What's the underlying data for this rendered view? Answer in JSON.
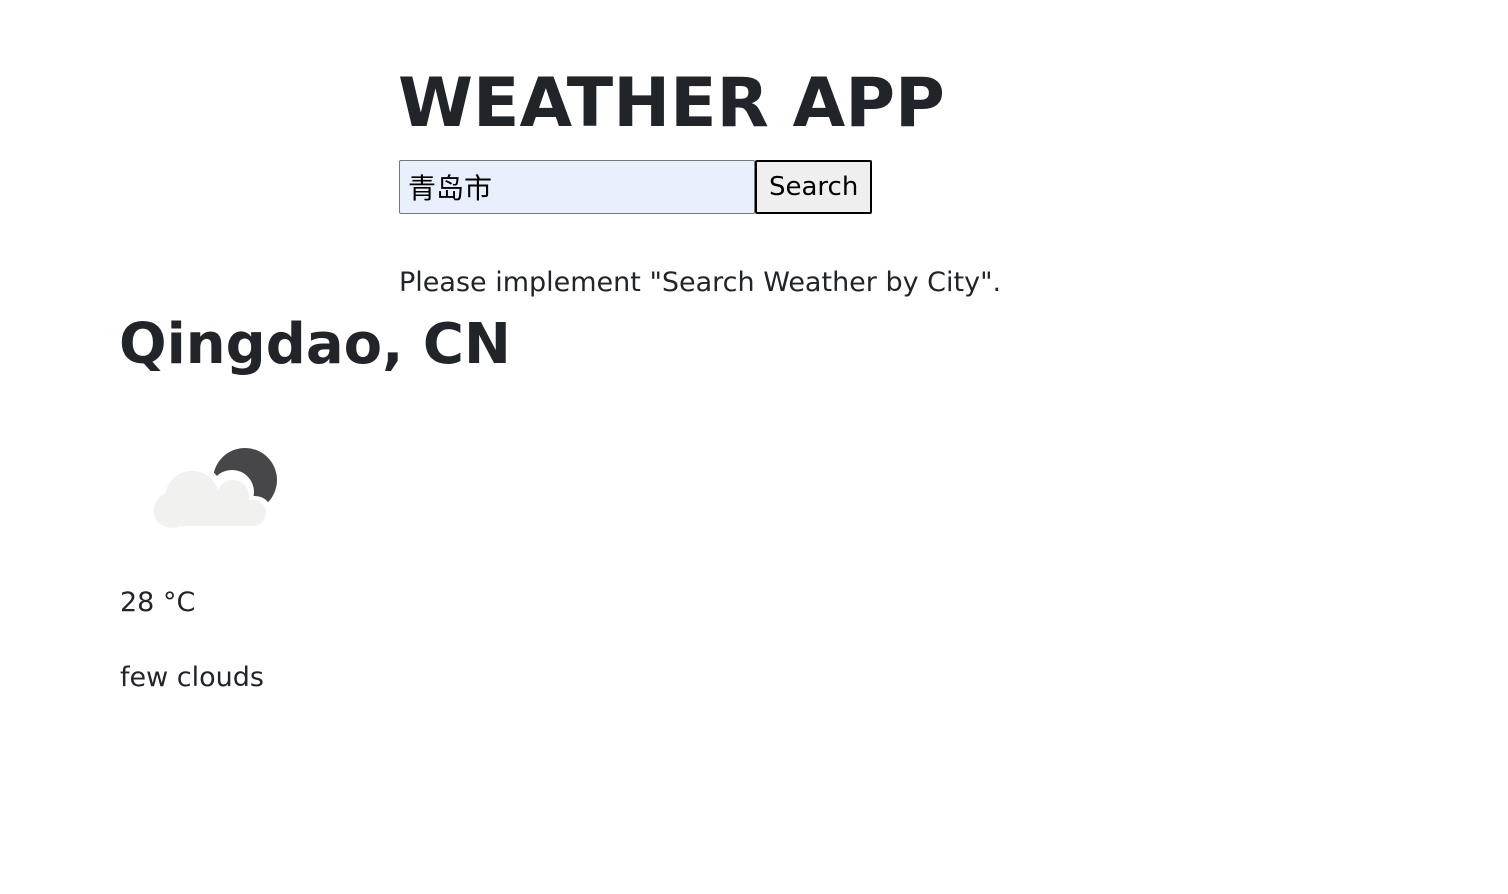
{
  "app": {
    "title": "WEATHER APP"
  },
  "search": {
    "value": "青岛市",
    "button_label": "Search"
  },
  "notice": "Please implement \"Search Weather by City\".",
  "weather": {
    "city": "Qingdao, CN",
    "icon": "few-clouds-night-icon",
    "temperature": "28 °C",
    "description": "few clouds"
  },
  "colors": {
    "text": "#212529",
    "input_background": "#e8f0fe",
    "button_background": "#efefef",
    "cloud": "#f1f1f0",
    "moon": "#47474a"
  }
}
